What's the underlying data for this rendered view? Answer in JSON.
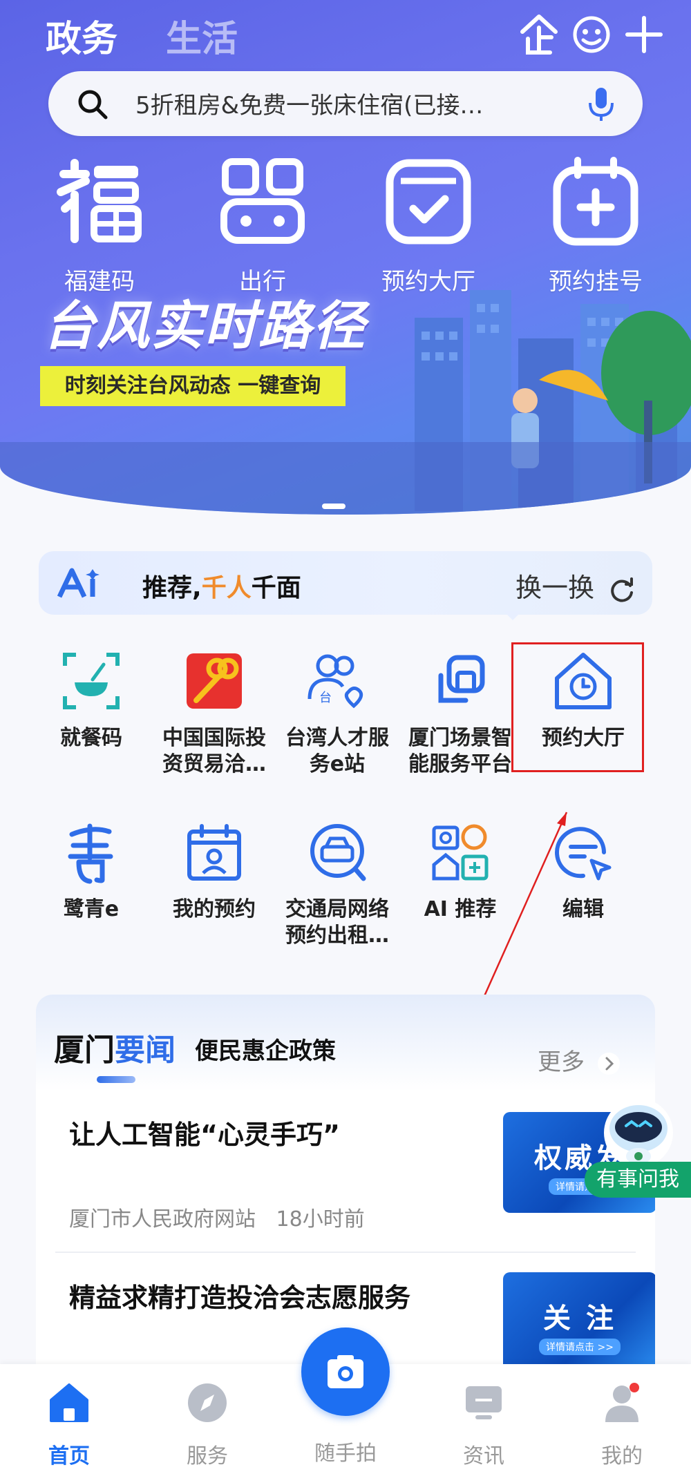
{
  "header": {
    "tabs": [
      "政务",
      "生活"
    ],
    "icons": [
      "enterprise-icon",
      "support-icon",
      "plus-icon"
    ]
  },
  "search": {
    "placeholder": "5折租房&免费一张床住宿(已接…"
  },
  "quick_actions": [
    "福建码",
    "出行",
    "预约大厅",
    "预约挂号"
  ],
  "banner": {
    "title": "台风实时路径",
    "subtitle": "时刻关注台风动态 一键查询"
  },
  "recommend": {
    "title_a": "推荐,",
    "title_mid": "千人",
    "title_b": "千面",
    "refresh_label": "换一换"
  },
  "grid": [
    {
      "label": "就餐码",
      "icon": "meal-code-icon"
    },
    {
      "label": "中国国际投资贸易洽…",
      "icon": "trade-fair-icon"
    },
    {
      "label": "台湾人才服务e站",
      "icon": "talent-service-icon"
    },
    {
      "label": "厦门场景智能服务平台",
      "icon": "scene-platform-icon"
    },
    {
      "label": "预约大厅",
      "icon": "booking-hall-icon"
    },
    {
      "label": "鹭青e",
      "icon": "luqing-icon"
    },
    {
      "label": "我的预约",
      "icon": "my-booking-icon"
    },
    {
      "label": "交通局网络预约出租…",
      "icon": "taxi-icon"
    },
    {
      "label": "AI 推荐",
      "icon": "ai-recommend-icon"
    },
    {
      "label": "编辑",
      "icon": "edit-icon"
    }
  ],
  "news": {
    "title_a": "厦门",
    "title_b": "要闻",
    "tab2": "便民惠企政策",
    "more": "更多",
    "items": [
      {
        "title": "让人工智能“心灵手巧”",
        "source": "厦门市人民政府网站",
        "time": "18小时前",
        "thumb_text": "权威发",
        "thumb_sub": "详情请点击"
      },
      {
        "title": "精益求精打造投洽会志愿服务",
        "thumb_text": "关 注",
        "thumb_sub": "详情请点击 >>"
      }
    ]
  },
  "assistant": {
    "label": "有事问我"
  },
  "bottom_nav": [
    {
      "label": "首页",
      "active": true
    },
    {
      "label": "服务"
    },
    {
      "label": "随手拍"
    },
    {
      "label": "资讯"
    },
    {
      "label": "我的"
    }
  ],
  "colors": {
    "primary": "#1d6ff2",
    "highlight": "#e02020",
    "accent": "#f08b2c"
  }
}
